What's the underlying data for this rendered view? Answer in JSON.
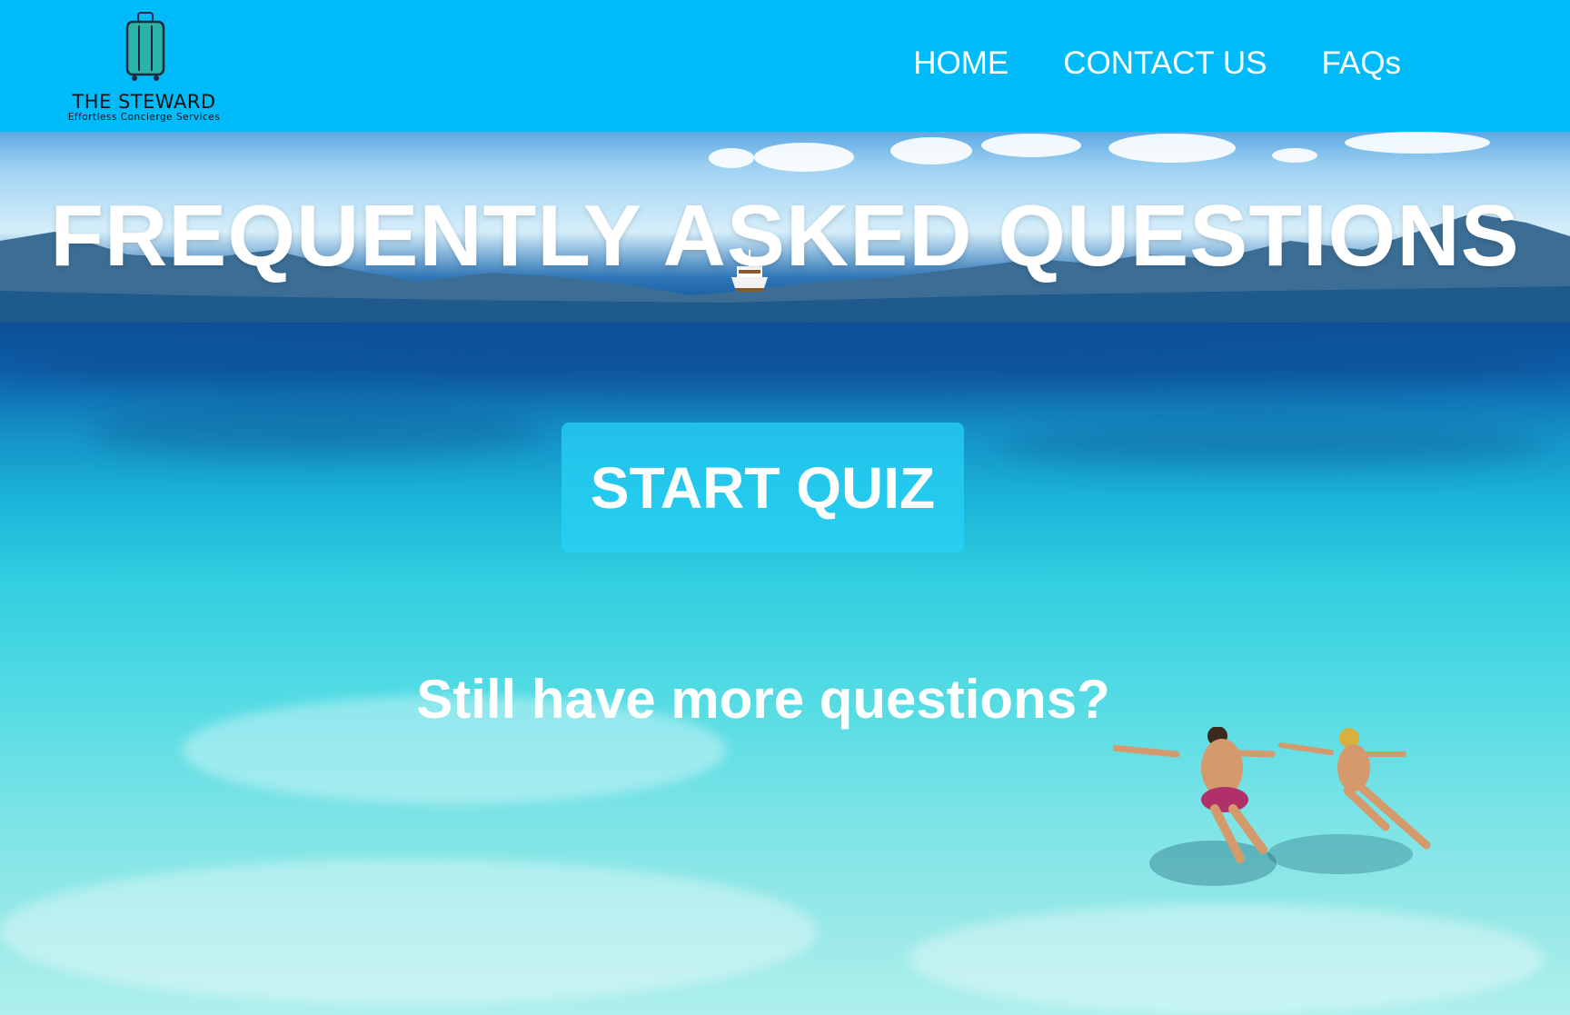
{
  "header": {
    "logo": {
      "title": "THE STEWARD",
      "subtitle": "Effortless Concierge Services",
      "icon": "suitcase-icon"
    },
    "nav": [
      {
        "label": "HOME"
      },
      {
        "label": "CONTACT US"
      },
      {
        "label": "FAQs"
      }
    ],
    "background_color": "#00bbf9"
  },
  "hero": {
    "title": "FREQUENTLY ASKED QUESTIONS",
    "quiz_button": "START QUIZ",
    "more_questions": "Still have more questions?",
    "background_image": "tropical sea with boat and two swimmers"
  }
}
